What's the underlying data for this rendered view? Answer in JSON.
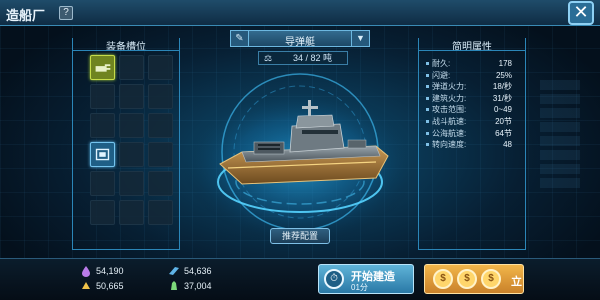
{
  "window": {
    "title": "造船厂",
    "help_label": "?",
    "close_label": "✕"
  },
  "equipment": {
    "title": "装备槽位",
    "slots": [
      {
        "state": "filled",
        "icon": "gun-icon"
      },
      {
        "state": "empty"
      },
      {
        "state": "empty"
      },
      {
        "state": "empty"
      },
      {
        "state": "empty"
      },
      {
        "state": "empty"
      },
      {
        "state": "empty"
      },
      {
        "state": "empty"
      },
      {
        "state": "empty"
      },
      {
        "state": "filled",
        "icon": "module-icon"
      },
      {
        "state": "empty"
      },
      {
        "state": "empty"
      },
      {
        "state": "empty"
      },
      {
        "state": "empty"
      },
      {
        "state": "empty"
      },
      {
        "state": "empty"
      },
      {
        "state": "empty"
      },
      {
        "state": "empty"
      }
    ]
  },
  "ship": {
    "name": "导弹艇",
    "capacity": "34 / 82 吨",
    "edit_icon": "edit-icon",
    "dropdown_icon": "chevron-down-icon",
    "recommend_label": "推荐配置"
  },
  "attributes": {
    "title": "简明属性",
    "rows": [
      {
        "label": "耐久:",
        "value": "178"
      },
      {
        "label": "闪避:",
        "value": "25%"
      },
      {
        "label": "弹道火力:",
        "value": "18/秒"
      },
      {
        "label": "建筑火力:",
        "value": "31/秒"
      },
      {
        "label": "攻击范围:",
        "value": "0~49"
      },
      {
        "label": "战斗航速:",
        "value": "20节"
      },
      {
        "label": "公海航速:",
        "value": "64节"
      },
      {
        "label": "转向速度:",
        "value": "48"
      }
    ]
  },
  "resources": {
    "oil": "54,190",
    "steel": "54,636",
    "gold": "50,665",
    "crystal": "37,004"
  },
  "actions": {
    "build_label": "开始建造",
    "build_time": "01分",
    "instant_label": "立"
  },
  "colors": {
    "accent": "#2b86b8",
    "build_button": "#2a79a6",
    "instant_button": "#e0a23e"
  }
}
